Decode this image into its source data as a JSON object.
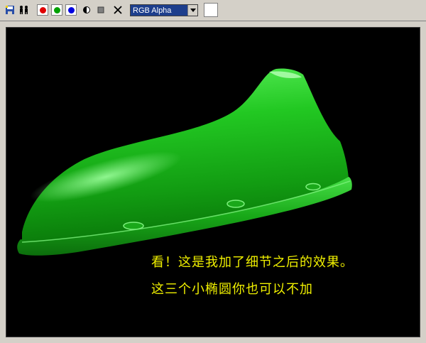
{
  "toolbar": {
    "channel_select": {
      "selected": "RGB Alpha"
    },
    "colors": {
      "red_channel": "#e00000",
      "green_channel": "#00a000",
      "blue_channel": "#0000e0",
      "bg_swatch": "#ffffff"
    },
    "icons": [
      "save-icon",
      "clone-icon",
      "red-channel-icon",
      "green-channel-icon",
      "blue-channel-icon",
      "alpha-toggle-icon",
      "mono-icon",
      "clear-icon",
      "dropdown-arrow-icon"
    ]
  },
  "viewport": {
    "caption_line1": "看！这是我加了细节之后的效果。",
    "caption_line2": "这三个小椭圆你也可以不加",
    "caption_color": "#f0f000",
    "model_color": "#1db81d"
  }
}
